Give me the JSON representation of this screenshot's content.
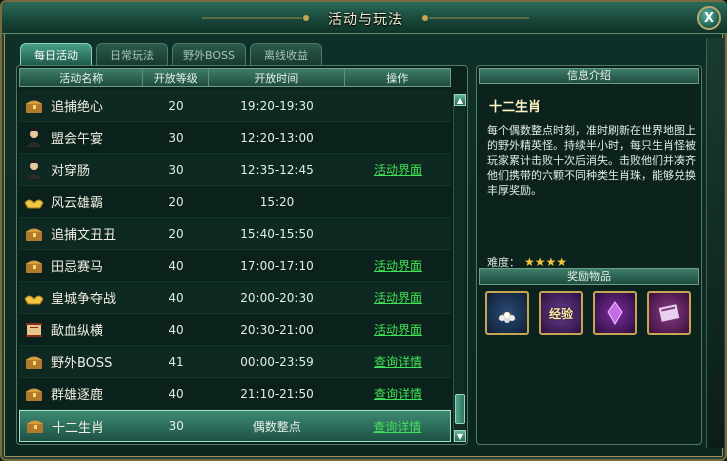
{
  "window": {
    "title": "活动与玩法",
    "close_label": "X"
  },
  "tabs": [
    {
      "label": "每日活动",
      "active": true
    },
    {
      "label": "日常玩法",
      "active": false
    },
    {
      "label": "野外BOSS",
      "active": false
    },
    {
      "label": "离线收益",
      "active": false
    }
  ],
  "table": {
    "headers": [
      "活动名称",
      "开放等级",
      "开放时间",
      "操作"
    ],
    "rows": [
      {
        "icon": "treasure-chest-icon",
        "name": "追捕绝心",
        "level": "20",
        "time": "19:20-19:30",
        "op": ""
      },
      {
        "icon": "character-portrait-icon",
        "name": "盟会午宴",
        "level": "30",
        "time": "12:20-13:00",
        "op": ""
      },
      {
        "icon": "character-portrait-icon",
        "name": "对穿肠",
        "level": "30",
        "time": "12:35-12:45",
        "op": "活动界面"
      },
      {
        "icon": "gold-ingot-icon",
        "name": "风云雄霸",
        "level": "20",
        "time": "15:20",
        "op": ""
      },
      {
        "icon": "treasure-chest-icon",
        "name": "追捕文丑丑",
        "level": "20",
        "time": "15:40-15:50",
        "op": ""
      },
      {
        "icon": "treasure-chest-icon",
        "name": "田忌赛马",
        "level": "40",
        "time": "17:00-17:10",
        "op": "活动界面"
      },
      {
        "icon": "gold-ingot-icon",
        "name": "皇城争夺战",
        "level": "40",
        "time": "20:00-20:30",
        "op": "活动界面"
      },
      {
        "icon": "scroll-icon",
        "name": "歃血纵横",
        "level": "40",
        "time": "20:30-21:00",
        "op": "活动界面"
      },
      {
        "icon": "treasure-chest-icon",
        "name": "野外BOSS",
        "level": "41",
        "time": "00:00-23:59",
        "op": "查询详情"
      },
      {
        "icon": "treasure-chest-icon",
        "name": "群雄逐鹿",
        "level": "40",
        "time": "21:10-21:50",
        "op": "查询详情"
      },
      {
        "icon": "treasure-chest-icon",
        "name": "十二生肖",
        "level": "30",
        "time": "偶数整点",
        "op": "查询详情",
        "selected": true
      }
    ]
  },
  "info": {
    "header": "信息介绍",
    "name": "十二生肖",
    "description": "每个偶数整点时刻，准时刷新在世界地图上的野外精英怪。持续半小时，每只生肖怪被玩家累计击败十次后消失。击败他们并凑齐他们携带的六颗不同种类生肖珠，能够兑换丰厚奖励。",
    "rating_label": "难度：",
    "rating_stars": 4
  },
  "rewards": {
    "header": "奖励物品",
    "items": [
      {
        "icon": "pearls-pouch-icon",
        "label": ""
      },
      {
        "icon": "experience-scroll-icon",
        "label": "经验"
      },
      {
        "icon": "purple-crystal-icon",
        "label": ""
      },
      {
        "icon": "book-icon",
        "label": ""
      }
    ]
  },
  "colors": {
    "accent": "#44e256",
    "gold": "#c6a653",
    "panel": "#0b211c",
    "header": "#3e7d6a"
  }
}
